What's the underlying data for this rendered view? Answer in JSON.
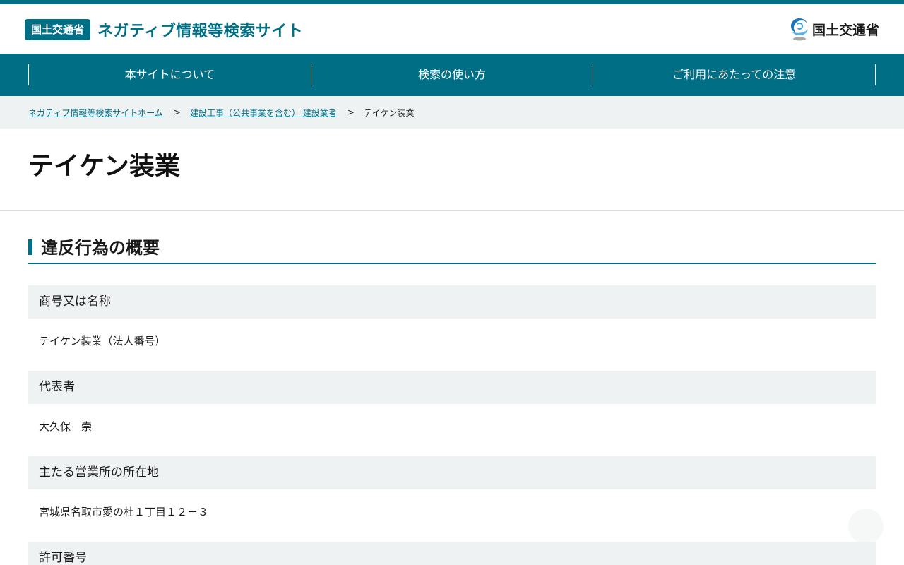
{
  "header": {
    "badge": "国土交通省",
    "site_title": "ネガティブ情報等検索サイト",
    "logo_text": "国土交通省",
    "logo_icon": "mlit-logo-icon",
    "accent_color": "#006e84"
  },
  "nav": {
    "items": [
      {
        "label": "本サイトについて"
      },
      {
        "label": "検索の使い方"
      },
      {
        "label": "ご利用にあたっての注意"
      }
    ]
  },
  "breadcrumb": {
    "home": "ネガティブ情報等検索サイトホーム",
    "category": "建設工事（公共事業を含む） 建設業者",
    "separator": ">",
    "current": "テイケン装業"
  },
  "page": {
    "title": "テイケン装業"
  },
  "section": {
    "title": "違反行為の概要",
    "items": [
      {
        "term": "商号又は名称",
        "value": "テイケン装業（法人番号）"
      },
      {
        "term": "代表者",
        "value": "大久保　崇"
      },
      {
        "term": "主たる営業所の所在地",
        "value": "宮城県名取市愛の杜１丁目１２－３"
      },
      {
        "term": "許可番号",
        "value": ""
      }
    ]
  }
}
